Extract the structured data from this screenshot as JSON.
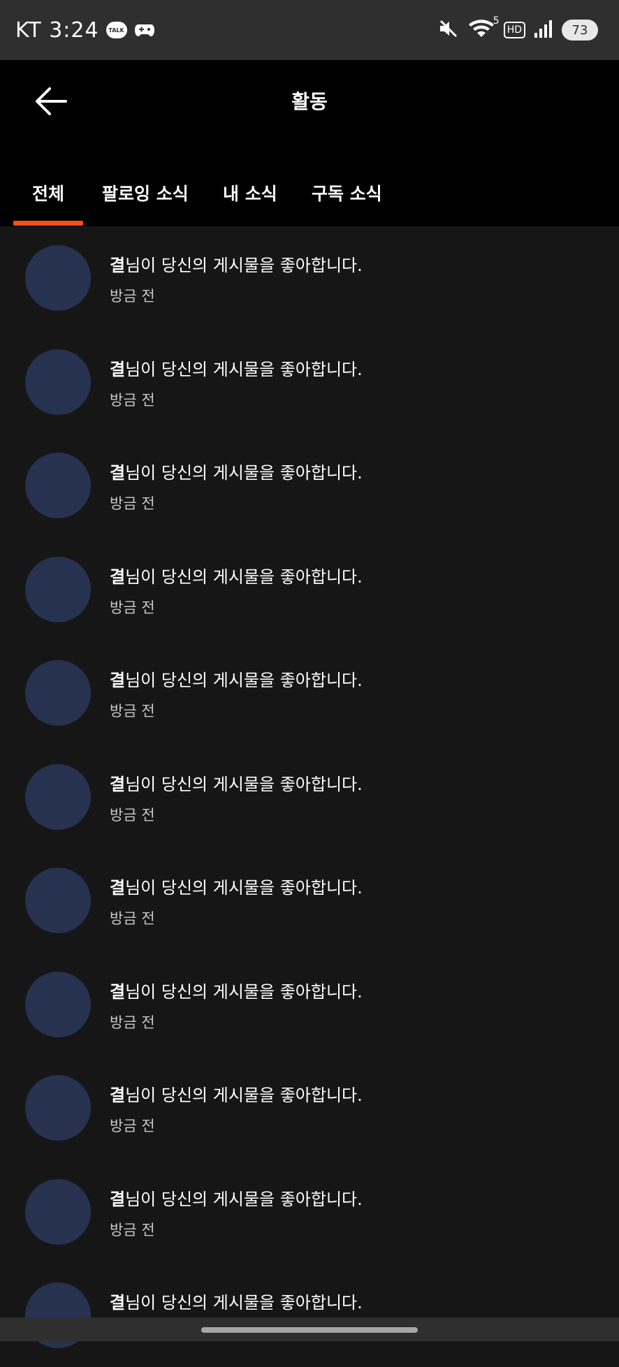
{
  "status_bar": {
    "carrier_time": "KT 3:24",
    "talk_label": "TALK",
    "network_digit": "5",
    "hd_label": "HD",
    "battery": "73"
  },
  "header": {
    "title": "활동"
  },
  "tabs": [
    {
      "label": "전체",
      "selected": true
    },
    {
      "label": "팔로잉 소식",
      "selected": false
    },
    {
      "label": "내 소식",
      "selected": false
    },
    {
      "label": "구독 소식",
      "selected": false
    }
  ],
  "accent_color": "#ff4f12",
  "avatar_color": "#26324f",
  "notifications": [
    {
      "user": "결",
      "text": "님이 당신의 게시물을 좋아합니다.",
      "time": "방금 전"
    },
    {
      "user": "결",
      "text": "님이 당신의 게시물을 좋아합니다.",
      "time": "방금 전"
    },
    {
      "user": "결",
      "text": "님이 당신의 게시물을 좋아합니다.",
      "time": "방금 전"
    },
    {
      "user": "결",
      "text": "님이 당신의 게시물을 좋아합니다.",
      "time": "방금 전"
    },
    {
      "user": "결",
      "text": "님이 당신의 게시물을 좋아합니다.",
      "time": "방금 전"
    },
    {
      "user": "결",
      "text": "님이 당신의 게시물을 좋아합니다.",
      "time": "방금 전"
    },
    {
      "user": "결",
      "text": "님이 당신의 게시물을 좋아합니다.",
      "time": "방금 전"
    },
    {
      "user": "결",
      "text": "님이 당신의 게시물을 좋아합니다.",
      "time": "방금 전"
    },
    {
      "user": "결",
      "text": "님이 당신의 게시물을 좋아합니다.",
      "time": "방금 전"
    },
    {
      "user": "결",
      "text": "님이 당신의 게시물을 좋아합니다.",
      "time": "방금 전"
    },
    {
      "user": "결",
      "text": "님이 당신의 게시물을 좋아합니다.",
      "time": ""
    }
  ]
}
